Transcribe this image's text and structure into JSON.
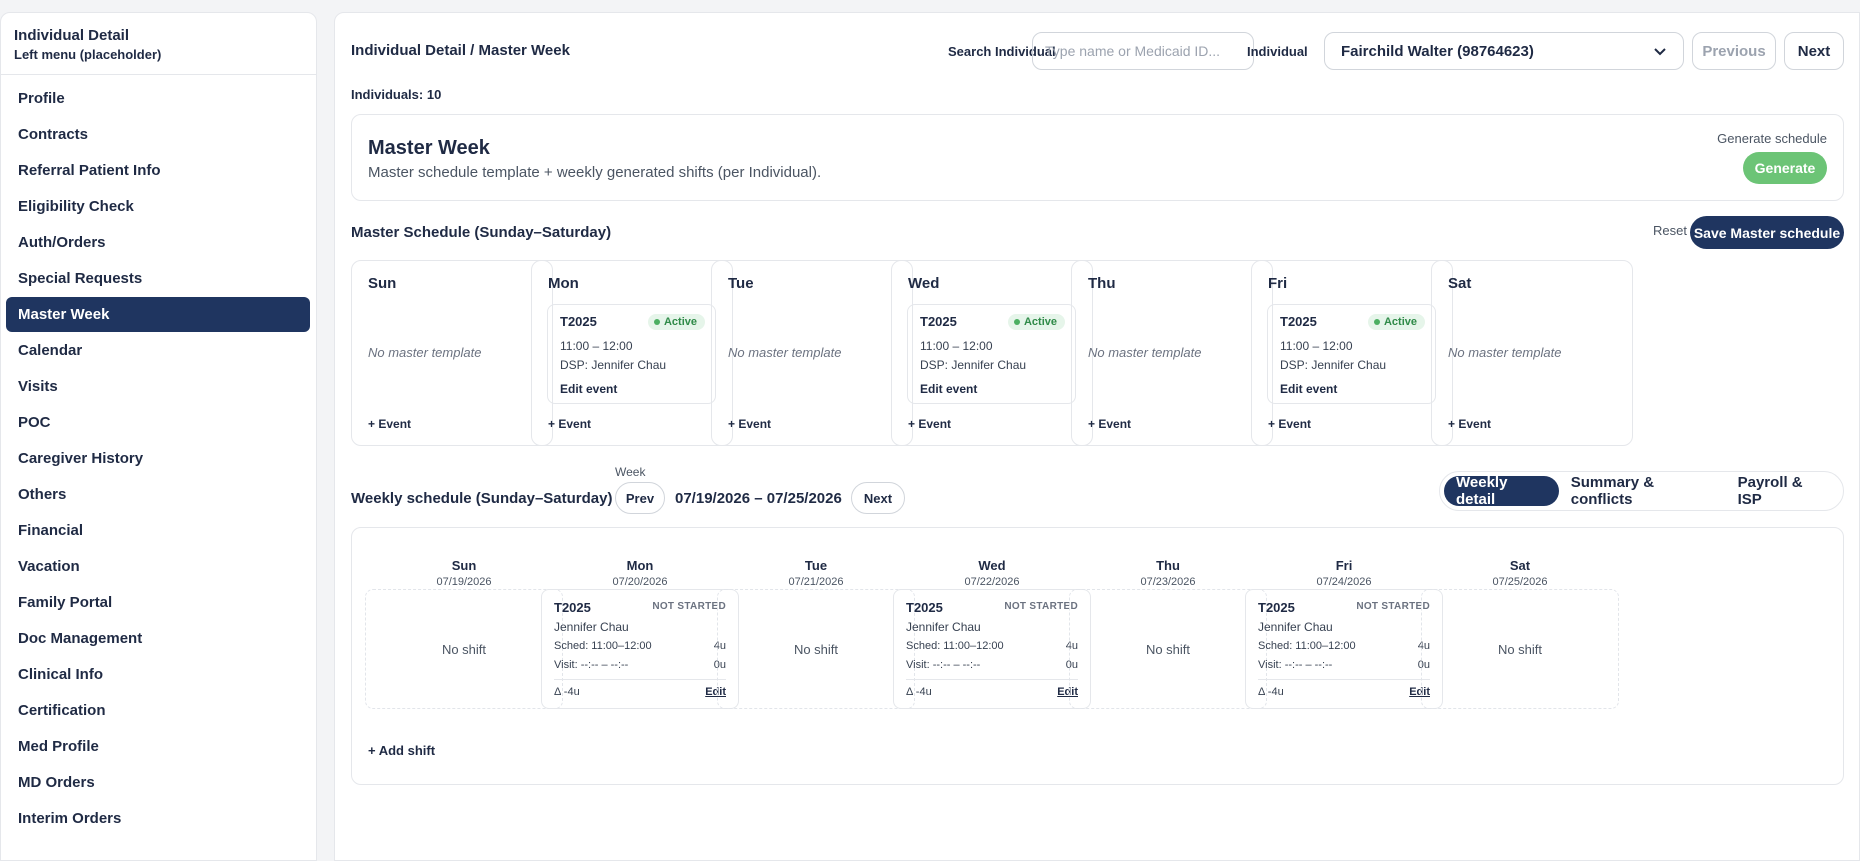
{
  "sidebar": {
    "title": "Individual Detail",
    "subtitle": "Left menu (placeholder)",
    "items": [
      {
        "label": "Profile"
      },
      {
        "label": "Contracts"
      },
      {
        "label": "Referral Patient Info"
      },
      {
        "label": "Eligibility Check"
      },
      {
        "label": "Auth/Orders"
      },
      {
        "label": "Special Requests"
      },
      {
        "label": "Master Week",
        "active": true
      },
      {
        "label": "Calendar"
      },
      {
        "label": "Visits"
      },
      {
        "label": "POC"
      },
      {
        "label": "Caregiver History"
      },
      {
        "label": "Others"
      },
      {
        "label": "Financial"
      },
      {
        "label": "Vacation"
      },
      {
        "label": "Family Portal"
      },
      {
        "label": "Doc Management"
      },
      {
        "label": "Clinical Info"
      },
      {
        "label": "Certification"
      },
      {
        "label": "Med Profile"
      },
      {
        "label": "MD Orders"
      },
      {
        "label": "Interim Orders"
      }
    ]
  },
  "header": {
    "breadcrumb": "Individual Detail / Master Week",
    "search_label": "Search Individual",
    "search_placeholder": "Type name or Medicaid ID...",
    "individual_label": "Individual",
    "individual_value": "Fairchild Walter (98764623)",
    "prev_label": "Previous",
    "next_label": "Next",
    "individuals_count": "Individuals: 10"
  },
  "master_week_card": {
    "title": "Master Week",
    "subtitle": "Master schedule template + weekly generated shifts (per Individual).",
    "generate_label": "Generate schedule",
    "generate_button": "Generate"
  },
  "master_schedule": {
    "title": "Master Schedule (Sunday–Saturday)",
    "reset_label": "Reset",
    "save_label": "Save Master schedule",
    "no_template": "No master template",
    "add_event": "+ Event",
    "days": [
      {
        "name": "Sun",
        "event": null
      },
      {
        "name": "Mon",
        "event": {
          "code": "T2025",
          "status": "Active",
          "time": "11:00 – 12:00",
          "dsp": "DSP: Jennifer Chau",
          "edit": "Edit event"
        }
      },
      {
        "name": "Tue",
        "event": null
      },
      {
        "name": "Wed",
        "event": {
          "code": "T2025",
          "status": "Active",
          "time": "11:00 – 12:00",
          "dsp": "DSP: Jennifer Chau",
          "edit": "Edit event"
        }
      },
      {
        "name": "Thu",
        "event": null
      },
      {
        "name": "Fri",
        "event": {
          "code": "T2025",
          "status": "Active",
          "time": "11:00 – 12:00",
          "dsp": "DSP: Jennifer Chau",
          "edit": "Edit event"
        }
      },
      {
        "name": "Sat",
        "event": null
      }
    ]
  },
  "weekly": {
    "title": "Weekly schedule (Sunday–Saturday)",
    "week_label": "Week",
    "prev": "Prev",
    "range": "07/19/2026 – 07/25/2026",
    "next": "Next",
    "tabs": [
      {
        "label": "Weekly detail",
        "active": true
      },
      {
        "label": "Summary & conflicts"
      },
      {
        "label": "Payroll & ISP"
      }
    ],
    "no_shift": "No shift",
    "add_shift": "+ Add shift",
    "days": [
      {
        "name": "Sun",
        "date": "07/19/2026",
        "shift": null
      },
      {
        "name": "Mon",
        "date": "07/20/2026",
        "shift": {
          "code": "T2025",
          "status": "NOT STARTED",
          "name": "Jennifer Chau",
          "sched": "Sched: 11:00–12:00",
          "sched_units": "4u",
          "visit": "Visit: --:-- – --:--",
          "visit_units": "0u",
          "delta": "Δ -4u",
          "edit": "Edit"
        }
      },
      {
        "name": "Tue",
        "date": "07/21/2026",
        "shift": null
      },
      {
        "name": "Wed",
        "date": "07/22/2026",
        "shift": {
          "code": "T2025",
          "status": "NOT STARTED",
          "name": "Jennifer Chau",
          "sched": "Sched: 11:00–12:00",
          "sched_units": "4u",
          "visit": "Visit: --:-- – --:--",
          "visit_units": "0u",
          "delta": "Δ -4u",
          "edit": "Edit"
        }
      },
      {
        "name": "Thu",
        "date": "07/23/2026",
        "shift": null
      },
      {
        "name": "Fri",
        "date": "07/24/2026",
        "shift": {
          "code": "T2025",
          "status": "NOT STARTED",
          "name": "Jennifer Chau",
          "sched": "Sched: 11:00–12:00",
          "sched_units": "4u",
          "visit": "Visit: --:-- – --:--",
          "visit_units": "0u",
          "delta": "Δ -4u",
          "edit": "Edit"
        }
      },
      {
        "name": "Sat",
        "date": "07/25/2026",
        "shift": null
      }
    ]
  },
  "colors": {
    "primary": "#1f3560",
    "success": "#6cc476",
    "active_badge_bg": "#e6f5ea"
  }
}
